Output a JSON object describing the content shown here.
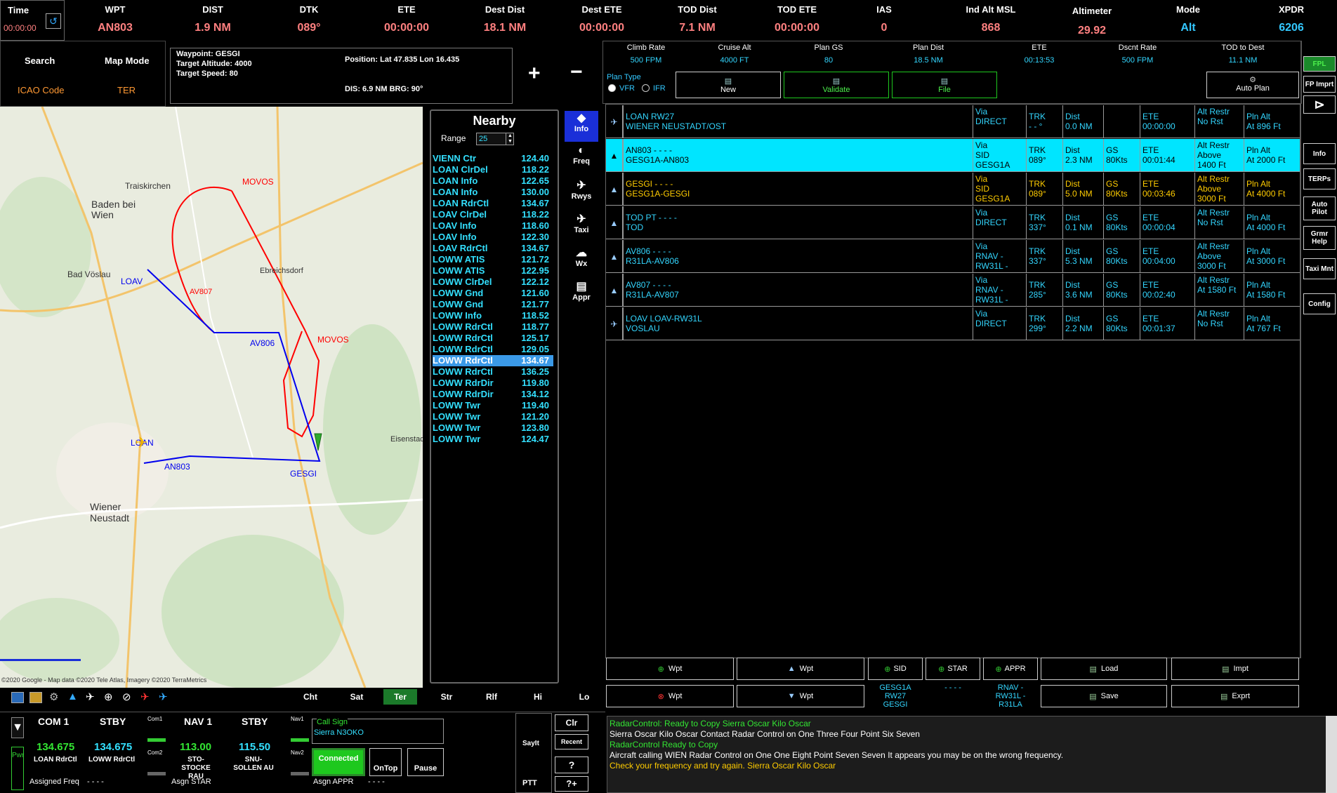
{
  "topbar": {
    "time_label": "Time",
    "time_value": "00:00:00",
    "fields": [
      {
        "label": "WPT",
        "value": "AN803"
      },
      {
        "label": "DIST",
        "value": "1.9 NM"
      },
      {
        "label": "DTK",
        "value": "089°"
      },
      {
        "label": "ETE",
        "value": "00:00:00"
      },
      {
        "label": "Dest Dist",
        "value": "18.1 NM"
      },
      {
        "label": "Dest ETE",
        "value": "00:00:00"
      },
      {
        "label": "TOD Dist",
        "value": "7.1 NM"
      },
      {
        "label": "TOD ETE",
        "value": "00:00:00"
      },
      {
        "label": "IAS",
        "value": "0"
      },
      {
        "label": "Ind Alt MSL",
        "value": "868"
      },
      {
        "label": "Altimeter",
        "value": "29.92"
      },
      {
        "label": "Mode",
        "value": "Alt"
      },
      {
        "label": "XPDR",
        "value": "6206"
      }
    ]
  },
  "search": {
    "search_label": "Search",
    "mapmode_label": "Map Mode",
    "icao_label": "ICAO Code",
    "mapmode_value": "TER"
  },
  "waypoint_box": {
    "title": "Waypoint: GESGI",
    "alt": "Target Altitude: 4000",
    "speed": "Target Speed: 80",
    "position": "Position: Lat 47.835 Lon 16.435",
    "dis": "DIS: 6.9 NM  BRG: 90°"
  },
  "zoom": {
    "plus": "+",
    "minus": "−"
  },
  "nearby": {
    "title": "Nearby",
    "range_label": "Range",
    "range_value": "25",
    "items": [
      {
        "name": "VIENN Ctr",
        "freq": "124.40"
      },
      {
        "name": "LOAN ClrDel",
        "freq": "118.22"
      },
      {
        "name": "LOAN Info",
        "freq": "122.65"
      },
      {
        "name": "LOAN Info",
        "freq": "130.00"
      },
      {
        "name": "LOAN RdrCtl",
        "freq": "134.67"
      },
      {
        "name": "LOAV ClrDel",
        "freq": "118.22"
      },
      {
        "name": "LOAV Info",
        "freq": "118.60"
      },
      {
        "name": "LOAV Info",
        "freq": "122.30"
      },
      {
        "name": "LOAV RdrCtl",
        "freq": "134.67"
      },
      {
        "name": "LOWW ATIS",
        "freq": "121.72"
      },
      {
        "name": "LOWW ATIS",
        "freq": "122.95"
      },
      {
        "name": "LOWW ClrDel",
        "freq": "122.12"
      },
      {
        "name": "LOWW Gnd",
        "freq": "121.60"
      },
      {
        "name": "LOWW Gnd",
        "freq": "121.77"
      },
      {
        "name": "LOWW Info",
        "freq": "118.52"
      },
      {
        "name": "LOWW RdrCtl",
        "freq": "118.77"
      },
      {
        "name": "LOWW RdrCtl",
        "freq": "125.17"
      },
      {
        "name": "LOWW RdrCtl",
        "freq": "129.05"
      },
      {
        "name": "LOWW RdrCtl",
        "freq": "134.67"
      },
      {
        "name": "LOWW RdrCtl",
        "freq": "136.25"
      },
      {
        "name": "LOWW RdrDir",
        "freq": "119.80"
      },
      {
        "name": "LOWW RdrDir",
        "freq": "134.12"
      },
      {
        "name": "LOWW Twr",
        "freq": "119.40"
      },
      {
        "name": "LOWW Twr",
        "freq": "121.20"
      },
      {
        "name": "LOWW Twr",
        "freq": "123.80"
      },
      {
        "name": "LOWW Twr",
        "freq": "124.47"
      }
    ]
  },
  "tools": [
    "Info",
    "Freq",
    "Rwys",
    "Taxi",
    "Wx",
    "Appr"
  ],
  "map": {
    "labels": [
      "MOVOS",
      "AV807",
      "LOAV",
      "AV806",
      "MOVOS",
      "LOAN",
      "AN803",
      "GESGI",
      "Baden bei Wien",
      "Traiskirchen",
      "Wiener Neustadt",
      "Bad Vöslau",
      "Ebreichsdorf",
      "Eisenstadt"
    ],
    "attribution": "©2020 Google - Map data ©2020 Tele Atlas, Imagery ©2020 TerraMetrics",
    "bottom_tabs": [
      "Cht",
      "Sat",
      "Ter",
      "Str",
      "Rlf",
      "Hi",
      "Lo"
    ]
  },
  "fpl_header": [
    {
      "label": "Climb Rate",
      "value": "500 FPM"
    },
    {
      "label": "Cruise Alt",
      "value": "4000 FT"
    },
    {
      "label": "Plan GS",
      "value": "80"
    },
    {
      "label": "Plan Dist",
      "value": "18.5 NM"
    },
    {
      "label": "ETE",
      "value": "00:13:53"
    },
    {
      "label": "Dscnt Rate",
      "value": "500 FPM"
    },
    {
      "label": "TOD to Dest",
      "value": "11.1 NM"
    }
  ],
  "plan_type": {
    "label": "Plan Type",
    "vfr": "VFR",
    "ifr": "IFR",
    "new": "New",
    "validate": "Validate",
    "file": "File",
    "auto_plan": "Auto Plan"
  },
  "fpl_rows": [
    {
      "wpt": "LOAN  RW27",
      "sub": "WIENER NEUSTADT/OST",
      "via1": "Via",
      "via2": "DIRECT",
      "via3": "",
      "trk1": "TRK",
      "trk2": "- - °",
      "dist1": "Dist",
      "dist2": "0.0 NM",
      "gs1": "",
      "gs2": "",
      "ete1": "ETE",
      "ete2": "00:00:00",
      "ar1": "Alt Restr",
      "ar2": "No Rst",
      "ar3": "",
      "pa1": "Pln Alt",
      "pa2": "At 896 Ft"
    },
    {
      "wpt": "AN803  - - - -",
      "sub": "GESG1A-AN803",
      "via1": "Via",
      "via2": "SID",
      "via3": "GESG1A",
      "trk1": "TRK",
      "trk2": "089°",
      "dist1": "Dist",
      "dist2": "2.3 NM",
      "gs1": "GS",
      "gs2": "80Kts",
      "ete1": "ETE",
      "ete2": "00:01:44",
      "ar1": "Alt Restr",
      "ar2": "Above",
      "ar3": "1400 Ft",
      "pa1": "Pln Alt",
      "pa2": "At 2000 Ft"
    },
    {
      "wpt": "GESGI  - - - -",
      "sub": "GESG1A-GESGI",
      "via1": "Via",
      "via2": "SID",
      "via3": "GESG1A",
      "trk1": "TRK",
      "trk2": "089°",
      "dist1": "Dist",
      "dist2": "5.0 NM",
      "gs1": "GS",
      "gs2": "80Kts",
      "ete1": "ETE",
      "ete2": "00:03:46",
      "ar1": "Alt Restr",
      "ar2": "Above",
      "ar3": "3000 Ft",
      "pa1": "Pln Alt",
      "pa2": "At 4000 Ft"
    },
    {
      "wpt": "TOD PT  - - - -",
      "sub": "TOD",
      "via1": "Via",
      "via2": "DIRECT",
      "via3": "",
      "trk1": "TRK",
      "trk2": "337°",
      "dist1": "Dist",
      "dist2": "0.1 NM",
      "gs1": "GS",
      "gs2": "80Kts",
      "ete1": "ETE",
      "ete2": "00:00:04",
      "ar1": "Alt Restr",
      "ar2": "No Rst",
      "ar3": "",
      "pa1": "Pln Alt",
      "pa2": "At 4000 Ft"
    },
    {
      "wpt": "AV806  - - - -",
      "sub": "R31LA-AV806",
      "via1": "Via",
      "via2": "RNAV -",
      "via3": "RW31L -",
      "trk1": "TRK",
      "trk2": "337°",
      "dist1": "Dist",
      "dist2": "5.3 NM",
      "gs1": "GS",
      "gs2": "80Kts",
      "ete1": "ETE",
      "ete2": "00:04:00",
      "ar1": "Alt Restr",
      "ar2": "Above",
      "ar3": "3000 Ft",
      "pa1": "Pln Alt",
      "pa2": "At 3000 Ft"
    },
    {
      "wpt": "AV807  - - - -",
      "sub": "R31LA-AV807",
      "via1": "Via",
      "via2": "RNAV -",
      "via3": "RW31L -",
      "trk1": "TRK",
      "trk2": "285°",
      "dist1": "Dist",
      "dist2": "3.6 NM",
      "gs1": "GS",
      "gs2": "80Kts",
      "ete1": "ETE",
      "ete2": "00:02:40",
      "ar1": "Alt Restr",
      "ar2": "At 1580 Ft",
      "ar3": "",
      "pa1": "Pln Alt",
      "pa2": "At 1580 Ft"
    },
    {
      "wpt": "LOAV  LOAV-RW31L",
      "sub": "VOSLAU",
      "via1": "Via",
      "via2": "DIRECT",
      "via3": "",
      "trk1": "TRK",
      "trk2": "299°",
      "dist1": "Dist",
      "dist2": "2.2 NM",
      "gs1": "GS",
      "gs2": "80Kts",
      "ete1": "ETE",
      "ete2": "00:01:37",
      "ar1": "Alt Restr",
      "ar2": "No Rst",
      "ar3": "",
      "pa1": "Pln Alt",
      "pa2": "At 767 Ft"
    }
  ],
  "side_buttons": [
    "FPL",
    "FP Imprt",
    "",
    "Info",
    "TERPs",
    "Auto Pilot",
    "Grmr Help",
    "Taxi Mnt",
    "Config"
  ],
  "fpl_bottom": {
    "add_wpt": "Wpt",
    "up_wpt": "Wpt",
    "sid": "SID",
    "star": "STAR",
    "appr": "APPR",
    "load": "Load",
    "impt": "Impt",
    "del_wpt": "Wpt",
    "down_wpt": "Wpt",
    "save": "Save",
    "exprt": "Exprt",
    "sid_val1": "GESG1A",
    "sid_val2": "RW27",
    "sid_val3": "GESGI",
    "star_val": "- - - -",
    "appr_val1": "RNAV -",
    "appr_val2": "RW31L -",
    "appr_val3": "R31LA"
  },
  "radio": {
    "com1_label": "COM 1",
    "stby1_label": "STBY",
    "nav1_label": "NAV 1",
    "stby2_label": "STBY",
    "com1_freq": "134.675",
    "com1_stby": "134.675",
    "nav1_freq": "113.00",
    "nav1_stby": "115.50",
    "com1_name": "LOAN RdrCtl",
    "com1_stby_name": "LOWW RdrCtl",
    "nav1_name": "STO-STOCKE RAU",
    "nav1_stby_name": "SNU-SOLLEN AU",
    "com1_small": "Com1",
    "com2_small": "Com2",
    "nav1_small": "Nav1",
    "nav2_small": "Nav2",
    "pwr": "Pwr",
    "assigned_freq": "Assigned Freq",
    "assigned_freq_val": "- - - -",
    "asgn_star": "Asgn STAR",
    "asgn_appr": "Asgn APPR",
    "asgn_appr_val": "- - - -",
    "call_sign_label": "Call Sign",
    "call_sign": "Sierra N3OKO",
    "connected": "Connected",
    "ontop": "OnTop",
    "pause": "Pause",
    "sayit": "SayIt",
    "ptt": "PTT",
    "clr": "Clr",
    "recent": "Recent",
    "q1": "?",
    "q2": "?+"
  },
  "messages": [
    {
      "text": "RadarControl:  Ready to Copy Sierra Oscar Kilo Oscar",
      "color": "#33e633"
    },
    {
      "text": "Sierra Oscar Kilo Oscar Contact Radar Control on One Three Four Point Six Seven",
      "color": "#ffffff"
    },
    {
      "text": "RadarControl Ready to Copy",
      "color": "#33e633"
    },
    {
      "text": "Aircraft calling WIEN Radar Control on One One Eight Point Seven Seven It appears you may be on the wrong frequency.",
      "color": "#ffffff"
    },
    {
      "text": "Check your frequency and try again. Sierra Oscar Kilo Oscar",
      "color": "#ffcc00"
    }
  ]
}
